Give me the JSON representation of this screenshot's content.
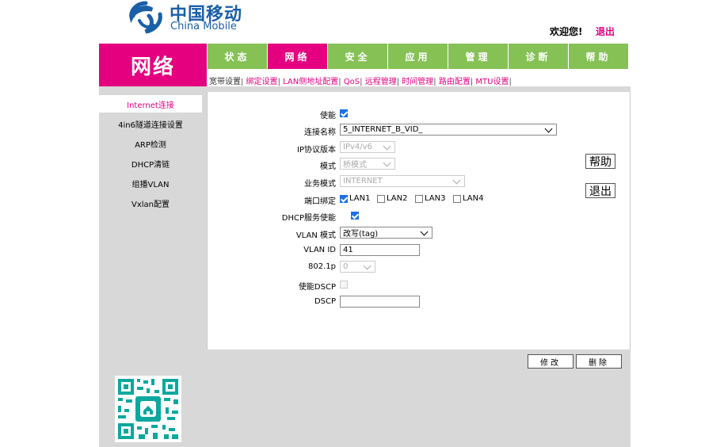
{
  "header": {
    "logo_cn": "中国移动",
    "logo_en": "China Mobile",
    "welcome": "欢迎您!",
    "logout": "退出"
  },
  "section_title": "网络",
  "tabs": [
    {
      "label": "状态",
      "active": false
    },
    {
      "label": "网络",
      "active": true
    },
    {
      "label": "安全",
      "active": false
    },
    {
      "label": "应用",
      "active": false
    },
    {
      "label": "管理",
      "active": false
    },
    {
      "label": "诊断",
      "active": false
    },
    {
      "label": "帮助",
      "active": false
    }
  ],
  "submenu": [
    "宽带设置",
    "绑定设置",
    "LAN侧地址配置",
    "QoS",
    "远程管理",
    "时间管理",
    "路由配置",
    "MTU设置"
  ],
  "sidebar": [
    {
      "label": "Internet连接",
      "active": true
    },
    {
      "label": "4in6隧道连接设置",
      "active": false
    },
    {
      "label": "ARP检测",
      "active": false
    },
    {
      "label": "DHCP清链",
      "active": false
    },
    {
      "label": "组播VLAN",
      "active": false
    },
    {
      "label": "Vxlan配置",
      "active": false
    }
  ],
  "form": {
    "enable_label": "使能",
    "conn_name_label": "连接名称",
    "conn_name_value": "5_INTERNET_B_VID_",
    "ip_version_label": "IP协议版本",
    "ip_version_value": "IPv4/v6",
    "mode_label": "模式",
    "mode_value": "桥模式",
    "service_mode_label": "业务模式",
    "service_mode_value": "INTERNET",
    "port_bind_label": "端口绑定",
    "ports": [
      {
        "label": "LAN1",
        "checked": true
      },
      {
        "label": "LAN2",
        "checked": false
      },
      {
        "label": "LAN3",
        "checked": false
      },
      {
        "label": "LAN4",
        "checked": false
      }
    ],
    "dhcp_label": "DHCP服务使能",
    "vlan_mode_label": "VLAN 模式",
    "vlan_mode_value": "改写(tag)",
    "vlan_id_label": "VLAN ID",
    "vlan_id_value": "41",
    "p8021_label": "802.1p",
    "p8021_value": "0",
    "dscp_enable_label": "使能DSCP",
    "dscp_label": "DSCP",
    "dscp_value": ""
  },
  "side_buttons": {
    "help": "帮助",
    "exit": "退出"
  },
  "bottom_buttons": {
    "modify": "修改",
    "delete": "删除"
  },
  "colors": {
    "brand_pink": "#e4007f",
    "nav_green": "#86c156",
    "frame_gray": "#d8d8d8",
    "logo_blue": "#1a5fa8"
  }
}
